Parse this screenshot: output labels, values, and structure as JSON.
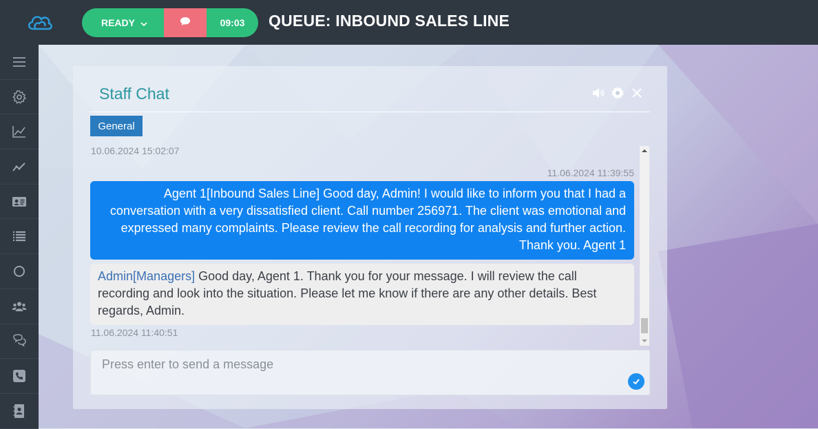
{
  "header": {
    "status_label": "READY",
    "timer": "09:03",
    "queue_title": "QUEUE: INBOUND SALES LINE"
  },
  "sidebar": {
    "items": [
      {
        "icon": "menu-icon"
      },
      {
        "icon": "gear-icon"
      },
      {
        "icon": "area-chart-icon"
      },
      {
        "icon": "line-chart-icon"
      },
      {
        "icon": "contact-card-icon"
      },
      {
        "icon": "list-icon"
      },
      {
        "icon": "circle-icon"
      },
      {
        "icon": "users-icon"
      },
      {
        "icon": "chat-bubbles-icon"
      },
      {
        "icon": "phone-icon"
      },
      {
        "icon": "address-book-icon"
      }
    ]
  },
  "chat": {
    "title": "Staff Chat",
    "tab_label": "General",
    "top_timestamp": "10.06.2024 15:02:07",
    "messages": [
      {
        "direction": "outgoing",
        "timestamp": "11.06.2024 11:39:55",
        "text": "Agent 1[Inbound Sales Line] Good day, Admin! I would like to inform you that I had a conversation with a very dissatisfied client. Call number 256971. The client was emotional and expressed many complaints. Please review the call recording for analysis and further action. Thank you. Agent 1"
      },
      {
        "direction": "incoming",
        "author": "Admin",
        "group": "Managers",
        "text": " Good day, Agent 1. Thank you for your message. I will review the call recording and look into the situation. Please let me know if there are any other details. Best regards, Admin.",
        "timestamp": "11.06.2024 11:40:51"
      }
    ],
    "input_placeholder": "Press enter to send a message"
  },
  "colors": {
    "topbar": "#2f3741",
    "ready_green": "#2ebf7d",
    "chat_red": "#ef6f7c",
    "title_teal": "#2b97a0",
    "tab_blue": "#2b7bbf",
    "bubble_blue": "#1183f0"
  }
}
